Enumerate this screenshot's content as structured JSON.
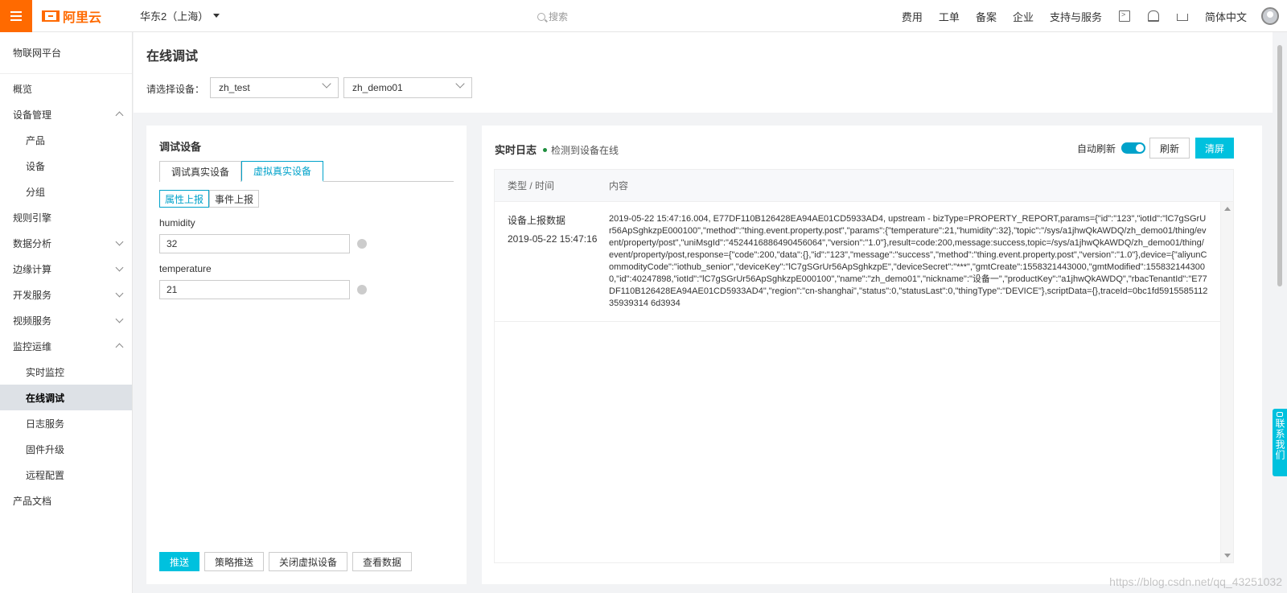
{
  "topbar": {
    "logo_text": "阿里云",
    "region": "华东2（上海）",
    "search_placeholder": "搜索",
    "nav": [
      "费用",
      "工单",
      "备案",
      "企业",
      "支持与服务"
    ],
    "language": "简体中文"
  },
  "sidebar": {
    "title": "物联网平台",
    "items": [
      {
        "label": "概览",
        "level": 1,
        "chevron": ""
      },
      {
        "label": "设备管理",
        "level": 1,
        "chevron": "up"
      },
      {
        "label": "产品",
        "level": 2,
        "chevron": ""
      },
      {
        "label": "设备",
        "level": 2,
        "chevron": ""
      },
      {
        "label": "分组",
        "level": 2,
        "chevron": ""
      },
      {
        "label": "规则引擎",
        "level": 1,
        "chevron": ""
      },
      {
        "label": "数据分析",
        "level": 1,
        "chevron": "down"
      },
      {
        "label": "边缘计算",
        "level": 1,
        "chevron": "down"
      },
      {
        "label": "开发服务",
        "level": 1,
        "chevron": "down"
      },
      {
        "label": "视频服务",
        "level": 1,
        "chevron": "down"
      },
      {
        "label": "监控运维",
        "level": 1,
        "chevron": "up"
      },
      {
        "label": "实时监控",
        "level": 2,
        "chevron": ""
      },
      {
        "label": "在线调试",
        "level": 2,
        "chevron": "",
        "active": true
      },
      {
        "label": "日志服务",
        "level": 2,
        "chevron": ""
      },
      {
        "label": "固件升级",
        "level": 2,
        "chevron": ""
      },
      {
        "label": "远程配置",
        "level": 2,
        "chevron": ""
      },
      {
        "label": "产品文档",
        "level": 1,
        "chevron": ""
      }
    ]
  },
  "header": {
    "title": "在线调试",
    "select_label": "请选择设备：",
    "product": "zh_test",
    "device": "zh_demo01"
  },
  "debug_panel": {
    "title": "调试设备",
    "tabs": [
      "调试真实设备",
      "虚拟真实设备"
    ],
    "subtabs": [
      "属性上报",
      "事件上报"
    ],
    "fields": [
      {
        "label": "humidity",
        "value": "32"
      },
      {
        "label": "temperature",
        "value": "21"
      }
    ],
    "buttons": [
      "推送",
      "策略推送",
      "关闭虚拟设备",
      "查看数据"
    ]
  },
  "log_panel": {
    "title": "实时日志",
    "status": "检测到设备在线",
    "auto_refresh_label": "自动刷新",
    "auto_refresh_on": true,
    "refresh_label": "刷新",
    "clear_label": "清屏",
    "columns": [
      "类型 / 时间",
      "内容"
    ],
    "rows": [
      {
        "type": "设备上报数据",
        "time": "2019-05-22 15:47:16",
        "content": "2019-05-22 15:47:16.004, E77DF110B126428EA94AE01CD5933AD4, upstream - bizType=PROPERTY_REPORT,params={\"id\":\"123\",\"iotId\":\"lC7gSGrUr56ApSghkzpE000100\",\"method\":\"thing.event.property.post\",\"params\":{\"temperature\":21,\"humidity\":32},\"topic\":\"/sys/a1jhwQkAWDQ/zh_demo01/thing/event/property/post\",\"uniMsgId\":\"4524416886490456064\",\"version\":\"1.0\"},result=code:200,message:success,topic=/sys/a1jhwQkAWDQ/zh_demo01/thing/event/property/post,response={\"code\":200,\"data\":{},\"id\":\"123\",\"message\":\"success\",\"method\":\"thing.event.property.post\",\"version\":\"1.0\"},device={\"aliyunCommodityCode\":\"iothub_senior\",\"deviceKey\":\"lC7gSGrUr56ApSghkzpE\",\"deviceSecret\":\"***\",\"gmtCreate\":1558321443000,\"gmtModified\":1558321443000,\"id\":40247898,\"iotId\":\"lC7gSGrUr56ApSghkzpE000100\",\"name\":\"zh_demo01\",\"nickname\":\"设备一\",\"productKey\":\"a1jhwQkAWDQ\",\"rbacTenantId\":\"E77DF110B126428EA94AE01CD5933AD4\",\"region\":\"cn-shanghai\",\"status\":0,\"statusLast\":0,\"thingType\":\"DEVICE\"},scriptData={},traceId=0bc1fd591558511235939314 6d3934"
      }
    ]
  },
  "contact_tab": "联系我们",
  "watermark": "https://blog.csdn.net/qq_43251032",
  "colors": {
    "brand": "#ff6a00",
    "accent": "#00c1de",
    "tab_active": "#00a2ca",
    "status_online": "#1e8e3e"
  }
}
